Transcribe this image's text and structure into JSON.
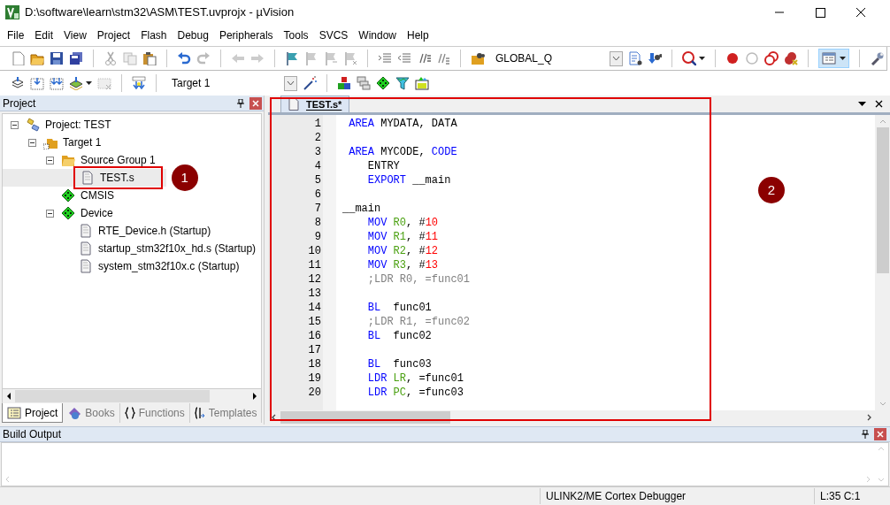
{
  "window": {
    "title": "D:\\software\\learn\\stm32\\ASM\\TEST.uvprojx - µVision"
  },
  "menu": [
    "File",
    "Edit",
    "View",
    "Project",
    "Flash",
    "Debug",
    "Peripherals",
    "Tools",
    "SVCS",
    "Window",
    "Help"
  ],
  "toolbar": {
    "find_combo": "GLOBAL_Q"
  },
  "build_toolbar": {
    "target_combo": "Target 1"
  },
  "project_panel": {
    "title": "Project",
    "tree": [
      {
        "label": "Project: TEST",
        "kind": "project",
        "expanded": true,
        "selected": false,
        "children": [
          {
            "label": "Target 1",
            "kind": "target",
            "expanded": true,
            "selected": false,
            "children": [
              {
                "label": "Source Group 1",
                "kind": "folder",
                "expanded": true,
                "selected": false,
                "children": [
                  {
                    "label": "TEST.s",
                    "kind": "file",
                    "selected": true,
                    "annotation": "1"
                  }
                ]
              },
              {
                "label": "CMSIS",
                "kind": "component",
                "selected": false
              },
              {
                "label": "Device",
                "kind": "component",
                "expanded": true,
                "selected": false,
                "children": [
                  {
                    "label": "RTE_Device.h (Startup)",
                    "kind": "file",
                    "selected": false
                  },
                  {
                    "label": "startup_stm32f10x_hd.s (Startup)",
                    "kind": "file",
                    "selected": false
                  },
                  {
                    "label": "system_stm32f10x.c (Startup)",
                    "kind": "file",
                    "selected": false
                  }
                ]
              }
            ]
          }
        ]
      }
    ],
    "tabs": [
      {
        "label": "Project",
        "selected": true
      },
      {
        "label": "Books",
        "selected": false
      },
      {
        "label": "Functions",
        "selected": false
      },
      {
        "label": "Templates",
        "selected": false
      }
    ]
  },
  "editor": {
    "tab": "TEST.s*",
    "annotation": "2",
    "lines": [
      {
        "number": "1",
        "kind": "directive",
        "segments": [
          {
            "kind": "keyword",
            "text": "AREA"
          },
          {
            "kind": "plain",
            "text": " MYDATA, DATA"
          }
        ]
      },
      {
        "number": "2",
        "kind": "blank"
      },
      {
        "number": "3",
        "kind": "directive",
        "segments": [
          {
            "kind": "keyword",
            "text": "AREA"
          },
          {
            "kind": "plain",
            "text": " MYCODE, "
          },
          {
            "kind": "keyword",
            "text": "CODE"
          }
        ]
      },
      {
        "number": "4",
        "kind": "instruction",
        "segments": [
          {
            "kind": "plain",
            "text": "ENTRY"
          }
        ]
      },
      {
        "number": "5",
        "kind": "instruction",
        "segments": [
          {
            "kind": "keyword",
            "text": "EXPORT"
          },
          {
            "kind": "plain",
            "text": " __main"
          }
        ]
      },
      {
        "number": "6",
        "kind": "blank"
      },
      {
        "number": "7",
        "kind": "label",
        "segments": [
          {
            "kind": "plain",
            "text": "__main"
          }
        ]
      },
      {
        "number": "8",
        "kind": "instruction",
        "segments": [
          {
            "kind": "keyword",
            "text": "MOV "
          },
          {
            "kind": "register",
            "text": "R0"
          },
          {
            "kind": "plain",
            "text": ", #"
          },
          {
            "kind": "number",
            "text": "10"
          }
        ]
      },
      {
        "number": "9",
        "kind": "instruction",
        "segments": [
          {
            "kind": "keyword",
            "text": "MOV "
          },
          {
            "kind": "register",
            "text": "R1"
          },
          {
            "kind": "plain",
            "text": ", #"
          },
          {
            "kind": "number",
            "text": "11"
          }
        ]
      },
      {
        "number": "10",
        "kind": "instruction",
        "segments": [
          {
            "kind": "keyword",
            "text": "MOV "
          },
          {
            "kind": "register",
            "text": "R2"
          },
          {
            "kind": "plain",
            "text": ", #"
          },
          {
            "kind": "number",
            "text": "12"
          }
        ]
      },
      {
        "number": "11",
        "kind": "instruction",
        "segments": [
          {
            "kind": "keyword",
            "text": "MOV "
          },
          {
            "kind": "register",
            "text": "R3"
          },
          {
            "kind": "plain",
            "text": ", #"
          },
          {
            "kind": "number",
            "text": "13"
          }
        ]
      },
      {
        "number": "12",
        "kind": "instruction",
        "segments": [
          {
            "kind": "comment",
            "text": ";LDR R0, =func01"
          }
        ]
      },
      {
        "number": "13",
        "kind": "blank"
      },
      {
        "number": "14",
        "kind": "instruction",
        "segments": [
          {
            "kind": "keyword",
            "text": "BL"
          },
          {
            "kind": "plain",
            "text": "  func01"
          }
        ]
      },
      {
        "number": "15",
        "kind": "instruction",
        "segments": [
          {
            "kind": "comment",
            "text": ";LDR R1, =func02"
          }
        ]
      },
      {
        "number": "16",
        "kind": "instruction",
        "segments": [
          {
            "kind": "keyword",
            "text": "BL"
          },
          {
            "kind": "plain",
            "text": "  func02"
          }
        ]
      },
      {
        "number": "17",
        "kind": "blank"
      },
      {
        "number": "18",
        "kind": "instruction",
        "segments": [
          {
            "kind": "keyword",
            "text": "BL"
          },
          {
            "kind": "plain",
            "text": "  func03"
          }
        ]
      },
      {
        "number": "19",
        "kind": "instruction",
        "segments": [
          {
            "kind": "keyword",
            "text": "LDR "
          },
          {
            "kind": "register",
            "text": "LR"
          },
          {
            "kind": "plain",
            "text": ", =func01"
          }
        ]
      },
      {
        "number": "20",
        "kind": "instruction",
        "segments": [
          {
            "kind": "keyword",
            "text": "LDR "
          },
          {
            "kind": "register",
            "text": "PC"
          },
          {
            "kind": "plain",
            "text": ", =func03"
          }
        ]
      }
    ]
  },
  "build_output": {
    "title": "Build Output"
  },
  "status_bar": {
    "debugger": "ULINK2/ME Cortex Debugger",
    "position": "L:35 C:1"
  }
}
